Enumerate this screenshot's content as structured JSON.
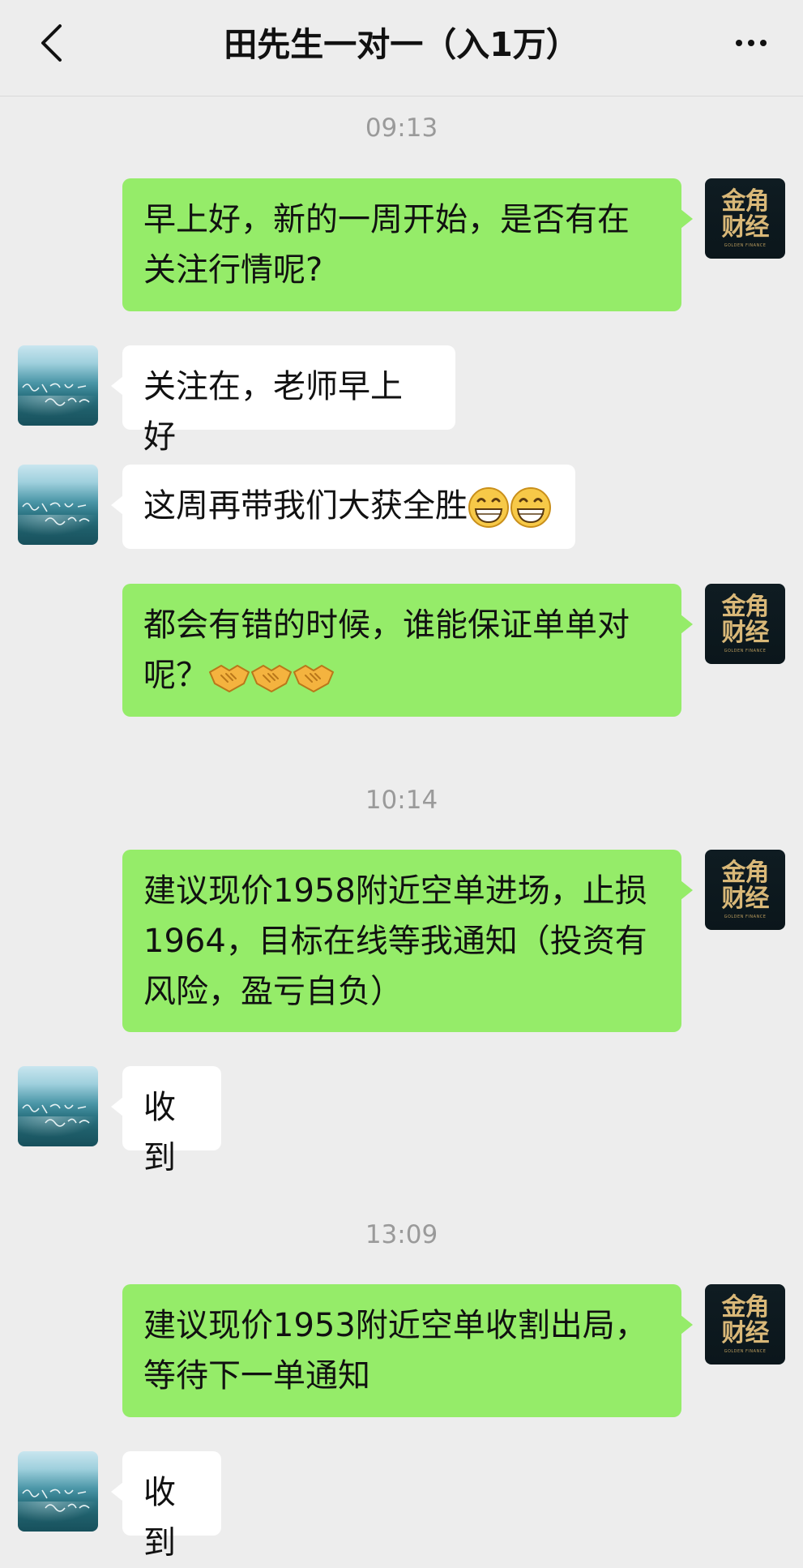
{
  "header": {
    "title": "田先生一对一（入1万）",
    "back_icon": "chevron-left-icon",
    "more_icon": "more-dots-icon"
  },
  "self_avatar": {
    "line1": "金角",
    "line2": "财经",
    "line3": "GOLDEN FINANCE"
  },
  "timestamps": [
    "09:13",
    "10:14",
    "13:09"
  ],
  "messages": [
    {
      "sender": "self",
      "text": "早上好，新的一周开始，是否有在关注行情呢?"
    },
    {
      "sender": "other",
      "text": "关注在，老师早上好"
    },
    {
      "sender": "other",
      "text": "这周再带我们大获全胜",
      "emojis": [
        "grin-emoji",
        "grin-emoji"
      ]
    },
    {
      "sender": "self",
      "text": "都会有错的时候，谁能保证单单对呢？",
      "emojis": [
        "handshake-emoji",
        "handshake-emoji",
        "handshake-emoji"
      ]
    },
    {
      "sender": "self",
      "text": "建议现价1958附近空单进场，止损1964，目标在线等我通知（投资有风险，盈亏自负）"
    },
    {
      "sender": "other",
      "text": "收到"
    },
    {
      "sender": "self",
      "text": "建议现价1953附近空单收割出局，等待下一单通知"
    },
    {
      "sender": "other",
      "text": "收到"
    }
  ],
  "colors": {
    "background": "#ededed",
    "self_bubble": "#95ec69",
    "other_bubble": "#ffffff",
    "timestamp": "#9a9a9a"
  }
}
